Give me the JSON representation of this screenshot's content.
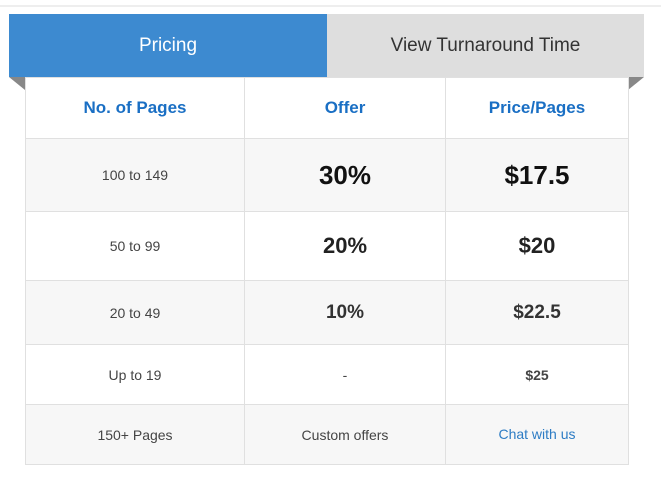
{
  "tabs": {
    "pricing": "Pricing",
    "turnaround": "View Turnaround Time"
  },
  "table": {
    "headers": [
      "No. of Pages",
      "Offer",
      "Price/Pages"
    ],
    "rows": [
      {
        "pages": "100 to 149",
        "offer": "30%",
        "price": "$17.5"
      },
      {
        "pages": "50 to 99",
        "offer": "20%",
        "price": "$20"
      },
      {
        "pages": "20 to 49",
        "offer": "10%",
        "price": "$22.5"
      },
      {
        "pages": "Up to 19",
        "offer": "-",
        "price": "$25"
      },
      {
        "pages": "150+ Pages",
        "offer": "Custom offers",
        "price": "Chat with us"
      }
    ]
  },
  "colors": {
    "active_tab": "#3d8ad0",
    "inactive_tab": "#dedede",
    "header_text": "#1a6fc4",
    "link": "#2d7cc4"
  }
}
